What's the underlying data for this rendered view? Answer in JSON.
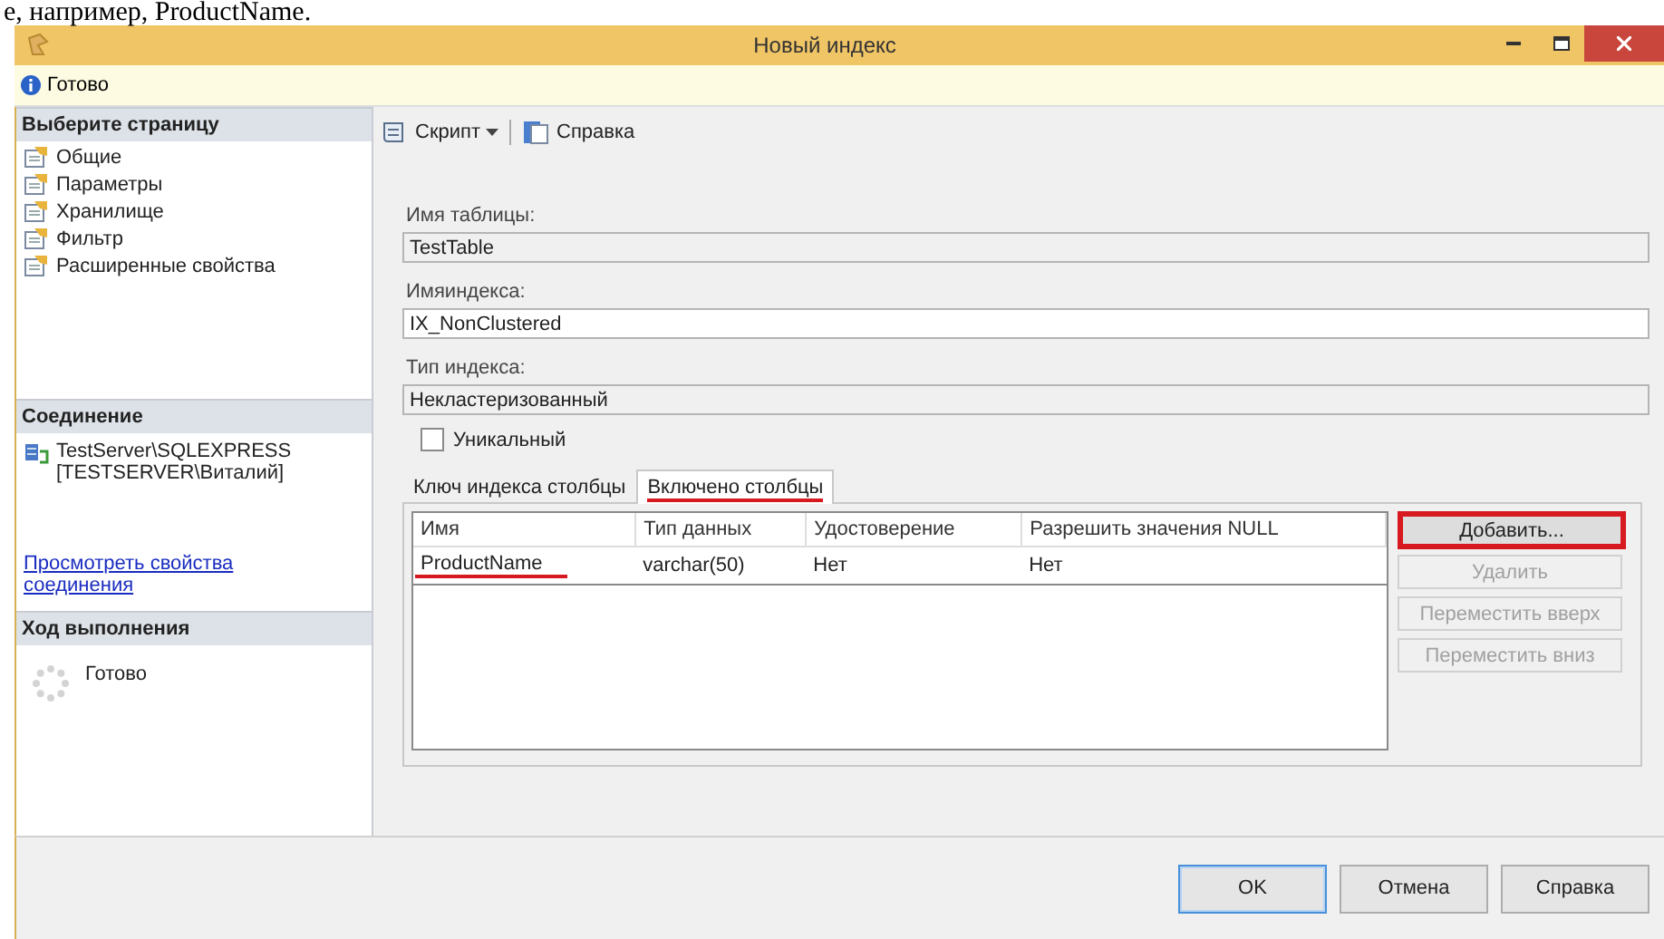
{
  "caption": "е, например, ProductName.",
  "window": {
    "title": "Новый индекс"
  },
  "status": {
    "text": "Готово"
  },
  "sidebar": {
    "pages_header": "Выберите страницу",
    "pages": [
      {
        "label": "Общие"
      },
      {
        "label": "Параметры"
      },
      {
        "label": "Хранилище"
      },
      {
        "label": "Фильтр"
      },
      {
        "label": "Расширенные свойства"
      }
    ],
    "connection_header": "Соединение",
    "connection": {
      "server": "TestServer\\SQLEXPRESS",
      "user": "[TESTSERVER\\Виталий]"
    },
    "connection_link": "Просмотреть свойства соединения",
    "progress_header": "Ход выполнения",
    "progress_status": "Готово"
  },
  "toolbar": [
    {
      "label": "Скрипт",
      "dropdown": true
    },
    {
      "label": "Справка",
      "dropdown": false
    }
  ],
  "fields": [
    {
      "label": "Имя таблицы:",
      "value": "TestTable",
      "disabled": true
    },
    {
      "label": "Имяиндекса:",
      "value": "IX_NonClustered",
      "disabled": false
    },
    {
      "label": "Тип индекса:",
      "value": "Некластеризованный",
      "disabled": true
    }
  ],
  "unique": {
    "label": "Уникальный",
    "checked": false
  },
  "tabs": [
    {
      "label": "Ключ индекса столбцы",
      "selected": false,
      "highlighted": false
    },
    {
      "label": "Включено столбцы",
      "selected": true,
      "highlighted": true
    }
  ],
  "table": {
    "columns": [
      "Имя",
      "Тип данных",
      "Удостоверение",
      "Разрешить значения NULL"
    ],
    "rows": [
      {
        "cells": [
          "ProductName",
          "varchar(50)",
          "Нет",
          "Нет"
        ],
        "highlighted": true
      }
    ]
  },
  "side_buttons": [
    {
      "label": "Добавить...",
      "disabled": false,
      "highlighted": true
    },
    {
      "label": "Удалить",
      "disabled": true,
      "highlighted": false
    },
    {
      "label": "Переместить вверх",
      "disabled": true,
      "highlighted": false
    },
    {
      "label": "Переместить вниз",
      "disabled": true,
      "highlighted": false
    }
  ],
  "footer_buttons": [
    {
      "label": "OK",
      "default": true
    },
    {
      "label": "Отмена",
      "default": false
    },
    {
      "label": "Справка",
      "default": false
    }
  ]
}
